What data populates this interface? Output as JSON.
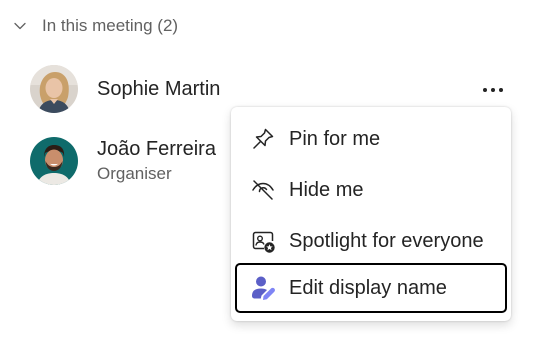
{
  "section": {
    "title": "In this meeting (2)"
  },
  "participants": [
    {
      "name": "Sophie Martin",
      "role": ""
    },
    {
      "name": "João Ferreira",
      "role": "Organiser"
    }
  ],
  "more_options": {
    "icon": "more-horizontal-icon"
  },
  "context_menu": {
    "items": [
      {
        "label": "Pin for me",
        "icon": "pin-icon"
      },
      {
        "label": "Hide me",
        "icon": "eye-off-icon"
      },
      {
        "label": "Spotlight for everyone",
        "icon": "spotlight-icon"
      },
      {
        "label": "Edit display name",
        "icon": "person-edit-icon",
        "focused": true
      }
    ]
  },
  "colors": {
    "text_primary": "#242424",
    "text_secondary": "#616161",
    "accent": "#5b5fc7",
    "focus_outline": "#000000"
  }
}
